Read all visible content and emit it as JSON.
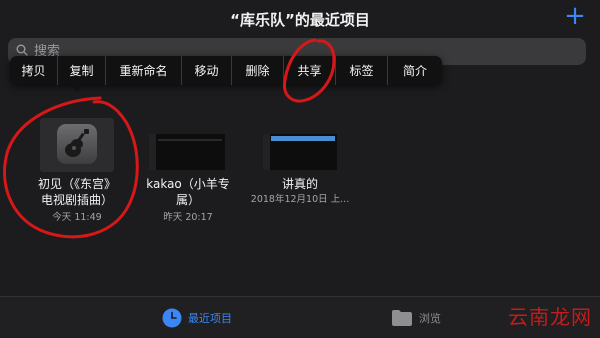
{
  "header": {
    "title": "“库乐队”的最近项目",
    "add_symbol": "+"
  },
  "search": {
    "placeholder": "搜索"
  },
  "context_menu": {
    "items": [
      "拷贝",
      "复制",
      "重新命名",
      "移动",
      "删除",
      "共享",
      "标签",
      "简介"
    ]
  },
  "files": [
    {
      "name_line1": "初见（《东宫》",
      "name_line2": "电视剧插曲）",
      "date": "今天 11:49"
    },
    {
      "name_line1": "kakao（小羊专",
      "name_line2": "属）",
      "date": "昨天 20:17"
    },
    {
      "name_line1": "讲真的",
      "name_line2": "",
      "date": "2018年12月10日 上..."
    }
  ],
  "tabbar": {
    "recent_label": "最近项目",
    "browse_label": "浏览"
  },
  "watermark": "云南龙网",
  "colors": {
    "accent": "#3a87f5",
    "background": "#1c1c1e",
    "annotation_red": "#d81818"
  }
}
